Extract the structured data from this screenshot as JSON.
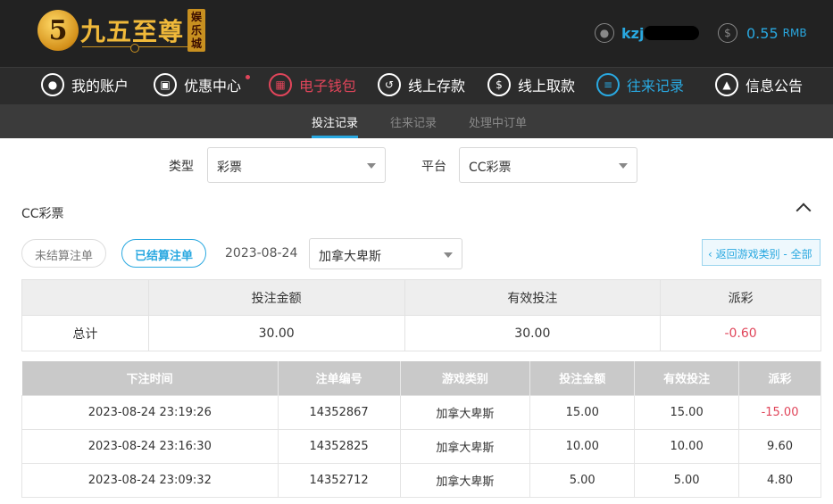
{
  "header": {
    "logo_mark": "5",
    "logo_text": "九五至尊",
    "logo_tag": "娱乐城",
    "username": "kzj",
    "balance": "0.55",
    "currency": "RMB"
  },
  "nav": [
    {
      "label": "我的账户",
      "icon": "user-icon"
    },
    {
      "label": "优惠中心",
      "icon": "gift-icon"
    },
    {
      "label": "电子钱包",
      "icon": "wallet-icon"
    },
    {
      "label": "线上存款",
      "icon": "deposit-icon"
    },
    {
      "label": "线上取款",
      "icon": "withdraw-icon"
    },
    {
      "label": "往来记录",
      "icon": "record-icon"
    },
    {
      "label": "信息公告",
      "icon": "bell-icon"
    }
  ],
  "subnav": [
    "投注记录",
    "往来记录",
    "处理中订单"
  ],
  "filters": {
    "type_label": "类型",
    "type_value": "彩票",
    "platform_label": "平台",
    "platform_value": "CC彩票"
  },
  "section": {
    "title": "CC彩票",
    "tab_unsettled": "未结算注单",
    "tab_settled": "已结算注单",
    "date": "2023-08-24",
    "game_value": "加拿大卑斯",
    "back_button": "‹ 返回游戏类别 - 全部"
  },
  "summary": {
    "headers": [
      "投注金额",
      "有效投注",
      "派彩"
    ],
    "row_label": "总计",
    "values": [
      "30.00",
      "30.00",
      "-0.60"
    ]
  },
  "detail": {
    "headers": [
      "下注时间",
      "注单编号",
      "游戏类别",
      "投注金额",
      "有效投注",
      "派彩"
    ],
    "rows": [
      [
        "2023-08-24 23:19:26",
        "14352867",
        "加拿大卑斯",
        "15.00",
        "15.00",
        "-15.00"
      ],
      [
        "2023-08-24 23:16:30",
        "14352825",
        "加拿大卑斯",
        "10.00",
        "10.00",
        "9.60"
      ],
      [
        "2023-08-24 23:09:32",
        "14352712",
        "加拿大卑斯",
        "5.00",
        "5.00",
        "4.80"
      ]
    ]
  },
  "colors": {
    "accent": "#29a8e0",
    "negative": "#e0455a",
    "brand_gold": "#f0b93a"
  }
}
